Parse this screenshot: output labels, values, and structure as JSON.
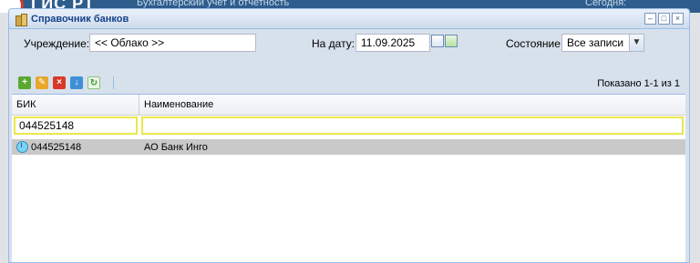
{
  "background": {
    "app_logo": "ГИС РТ",
    "app_subtitle": "Бухгалтерский учет и отчетность",
    "today_label": "Сегодня:"
  },
  "window": {
    "title": "Справочник банков",
    "icon": "bank-books-icon"
  },
  "filters": {
    "institution_label": "Учреждение:",
    "institution_value": "<< Облако >>",
    "date_label": "На дату:",
    "date_value": "11.09.2025",
    "state_label": "Состояние:",
    "state_value": "Все записи"
  },
  "toolbar": {
    "buttons": [
      {
        "name": "add-icon",
        "color": "#5aa832"
      },
      {
        "name": "edit-icon",
        "color": "#e9a72a"
      },
      {
        "name": "delete-icon",
        "color": "#d9382a"
      },
      {
        "name": "export-icon",
        "color": "#3f8fd6"
      },
      {
        "name": "refresh-icon",
        "color": "#53a84a"
      }
    ],
    "paging_text": "Показано 1-1 из 1"
  },
  "grid": {
    "columns": [
      "БИК",
      "Наименование"
    ],
    "filter_bik": "044525148",
    "filter_name": "",
    "rows": [
      {
        "bik": "044525148",
        "name": "АО Банк Инго",
        "status": "active-icon"
      }
    ]
  }
}
